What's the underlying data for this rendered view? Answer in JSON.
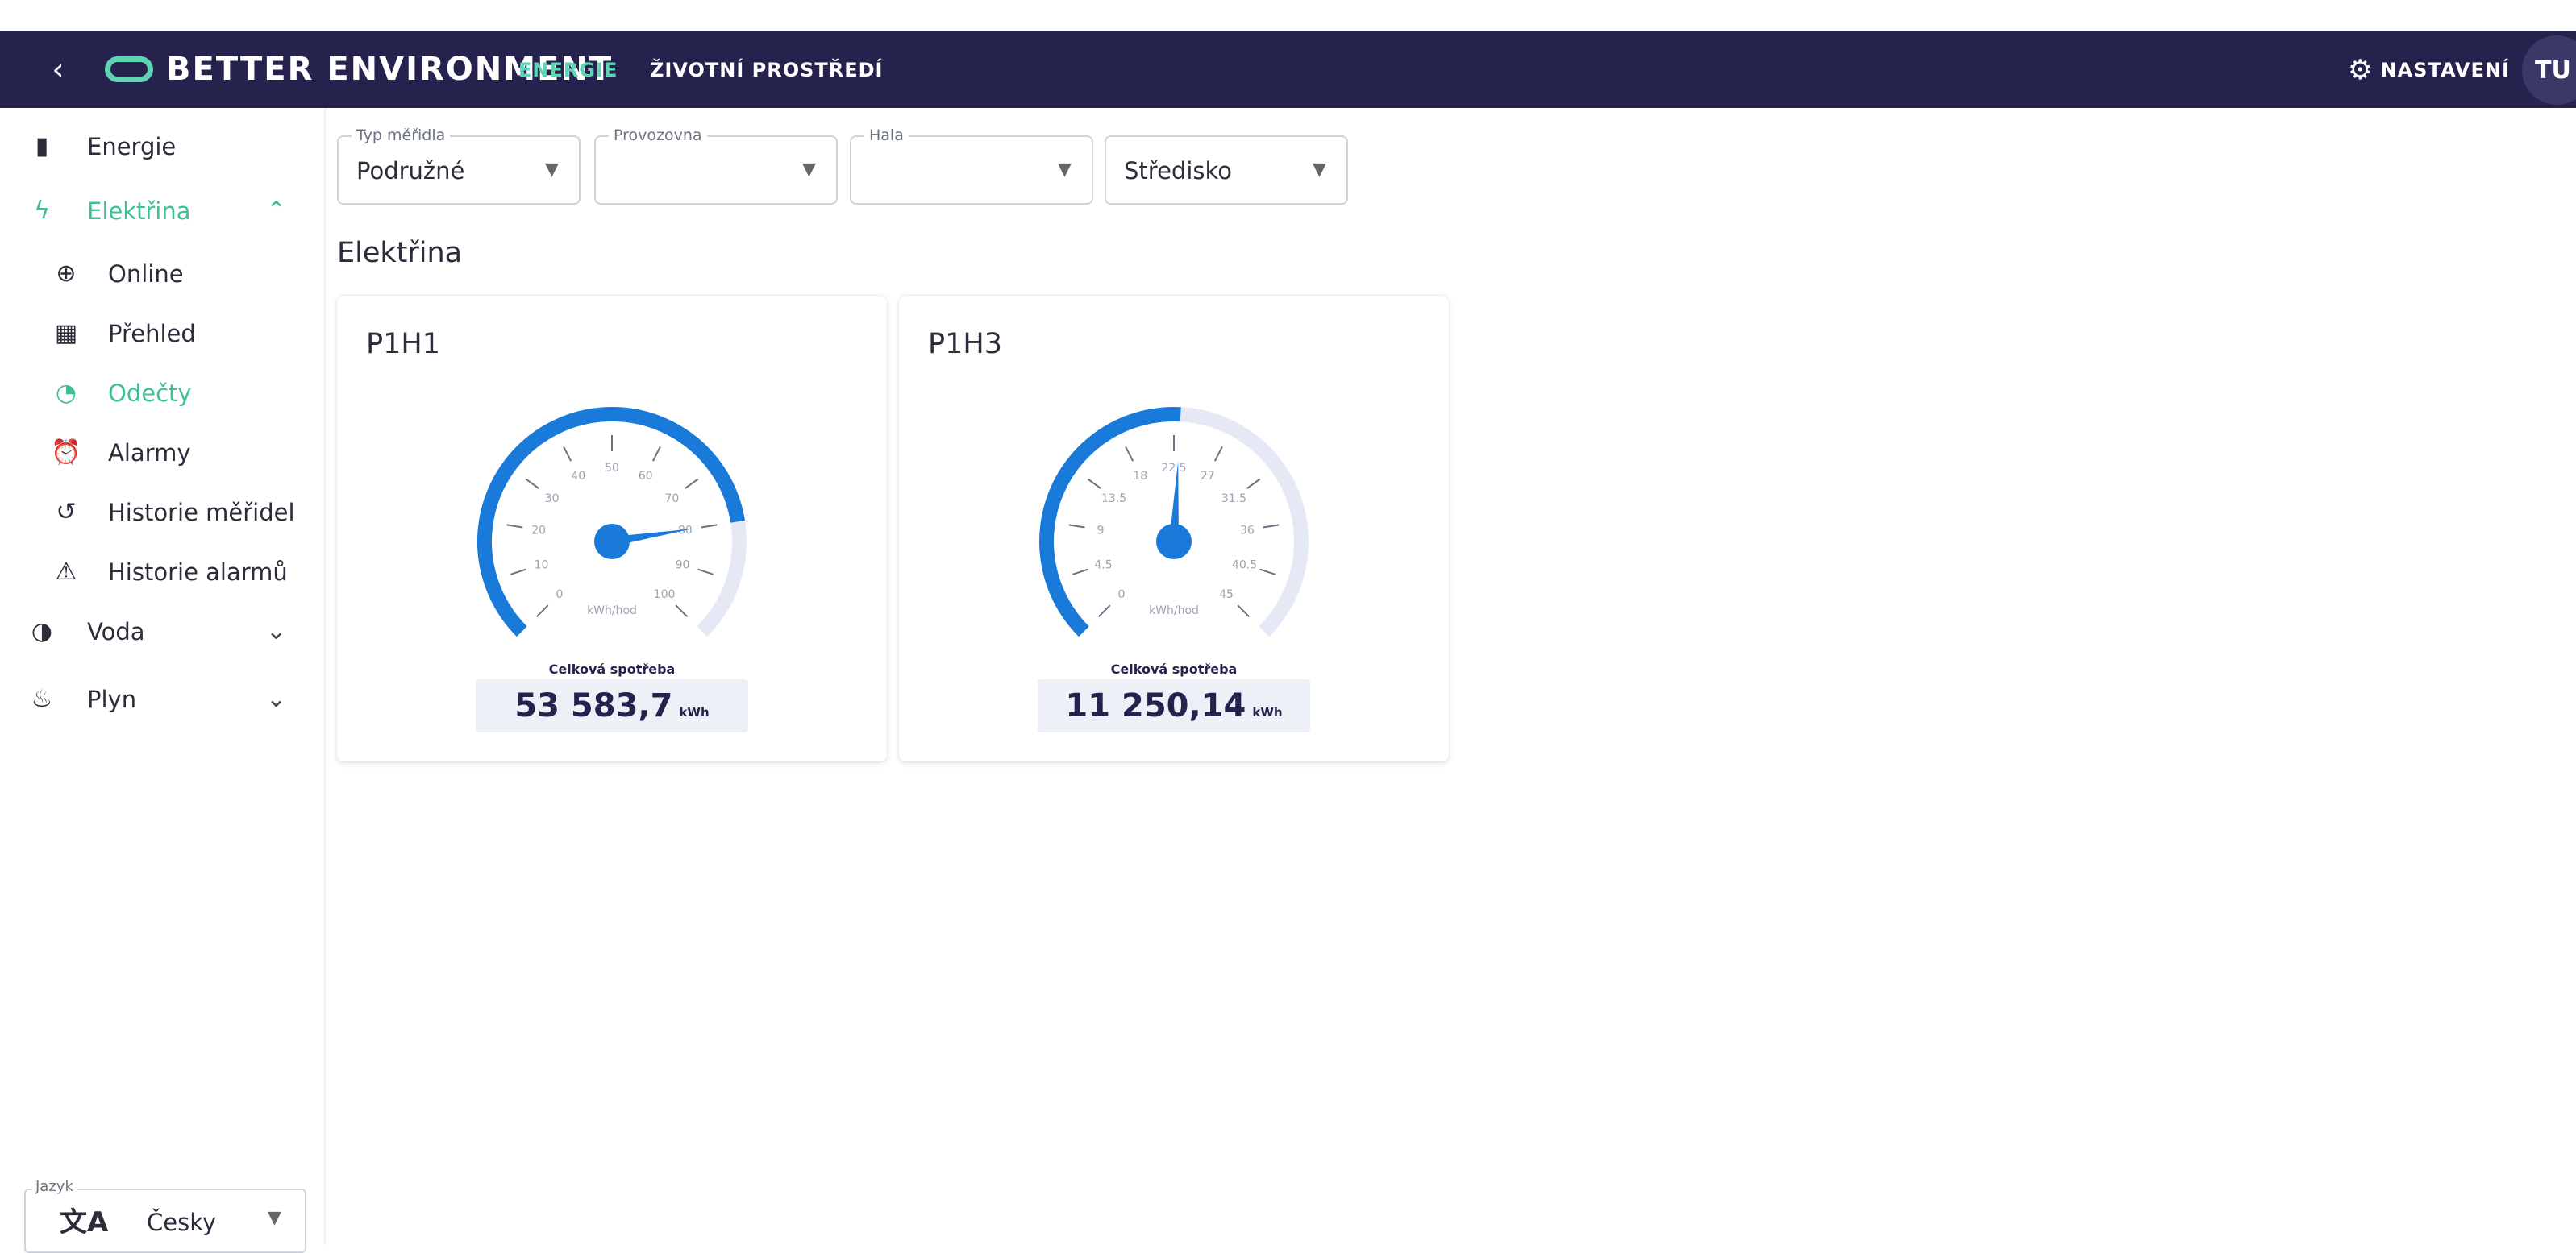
{
  "header": {
    "back_icon": "chevron-left-icon",
    "brand": "BETTER ENVIRONMENT",
    "nav": [
      {
        "label": "ENERGIE",
        "active": true
      },
      {
        "label": "ŽIVOTNÍ PROSTŘEDÍ",
        "active": false
      }
    ],
    "settings_label": "NASTAVENÍ",
    "settings_icon": "gear-icon",
    "avatar_initials": "TU",
    "accent_color": "#5fd3b3",
    "background_color": "#25234e"
  },
  "sidebar": {
    "items": [
      {
        "label": "Energie",
        "icon": "battery-icon",
        "glyph": "▮"
      },
      {
        "label": "Elektřina",
        "icon": "lightning-icon",
        "glyph": "ϟ",
        "active": true,
        "expanded": true
      },
      {
        "label": "Online",
        "icon": "globe-icon",
        "glyph": "⊕"
      },
      {
        "label": "Přehled",
        "icon": "dashboard-icon",
        "glyph": "▦"
      },
      {
        "label": "Odečty",
        "icon": "speedometer-icon",
        "glyph": "◔",
        "active": true
      },
      {
        "label": "Alarmy",
        "icon": "alarm-clock-icon",
        "glyph": "⏰"
      },
      {
        "label": "Historie měřidel",
        "icon": "history-icon",
        "glyph": "↺"
      },
      {
        "label": "Historie alarmů",
        "icon": "warning-icon",
        "glyph": "⚠"
      },
      {
        "label": "Voda",
        "icon": "water-icon",
        "glyph": "◑",
        "expanded": false
      },
      {
        "label": "Plyn",
        "icon": "flame-icon",
        "glyph": "♨",
        "expanded": false
      }
    ],
    "language": {
      "legend": "Jazyk",
      "value": "Česky",
      "icon": "translate-icon"
    }
  },
  "filters": [
    {
      "legend": "Typ měřidla",
      "value": "Podružné"
    },
    {
      "legend": "Provozovna",
      "value": ""
    },
    {
      "legend": "Hala",
      "value": ""
    },
    {
      "legend": "",
      "value": "Středisko"
    }
  ],
  "section_title": "Elektřina",
  "gauges": [
    {
      "title": "P1H1",
      "unit": "kWh/hod",
      "min": 0,
      "max": 100,
      "ticks": [
        "0",
        "10",
        "20",
        "30",
        "40",
        "50",
        "60",
        "70",
        "80",
        "90",
        "100"
      ],
      "value": 80,
      "total_label": "Celková spotřeba",
      "total_value": "53 583,7",
      "total_unit": "kWh"
    },
    {
      "title": "P1H3",
      "unit": "kWh/hod",
      "min": 0,
      "max": 45,
      "ticks": [
        "0",
        "4.5",
        "9",
        "13.5",
        "18",
        "22.5",
        "27",
        "31.5",
        "36",
        "40.5",
        "45"
      ],
      "value": 23,
      "total_label": "Celková spotřeba",
      "total_value": "11 250,14",
      "total_unit": "kWh"
    }
  ],
  "colors": {
    "gauge_fill": "#1a7ad9",
    "gauge_track": "#e5e9f5",
    "active_green": "#3fbf95"
  }
}
